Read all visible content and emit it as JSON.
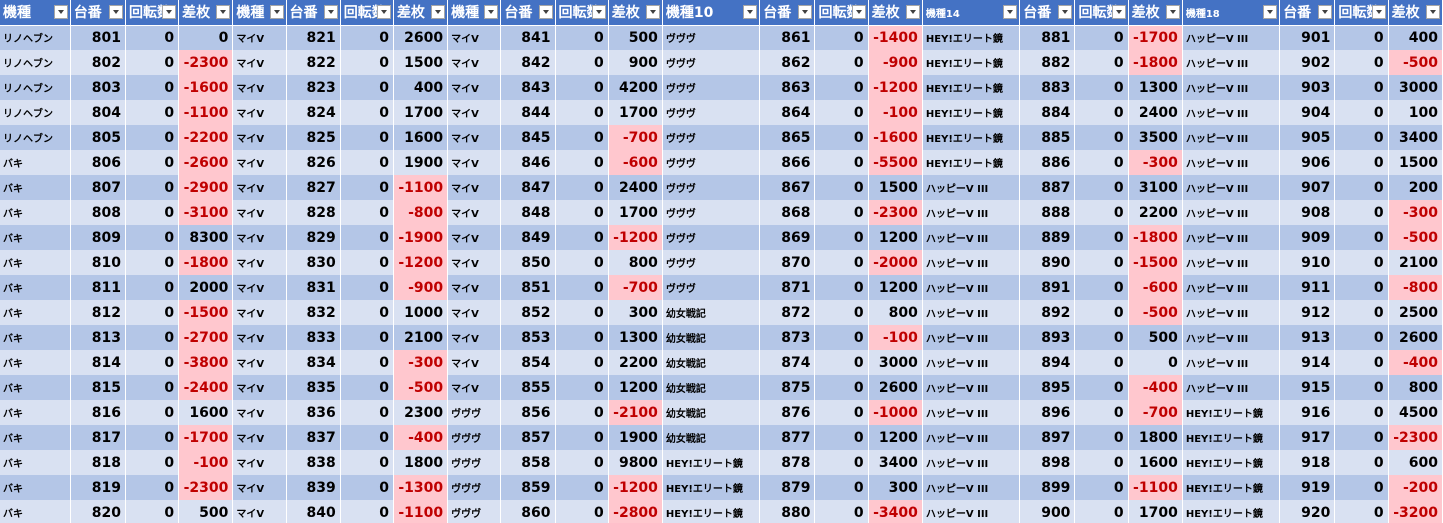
{
  "sheet": {
    "headers": [
      "機種",
      "台番",
      "回転数",
      "差枚",
      "機種",
      "台番",
      "回転数",
      "差枚",
      "機種",
      "台番",
      "回転数",
      "差枚",
      "機種10",
      "台番",
      "回転数",
      "差枚",
      "機種14",
      "台番",
      "回転数",
      "差枚",
      "機種18",
      "台番",
      "回転数",
      "差枚"
    ],
    "filter_button_icon": "filter-dropdown-icon",
    "colors": {
      "header_fill": "#4472c4",
      "row_band_dark": "#b4c6e7",
      "row_band_light": "#d9e1f2",
      "negative_fill": "#ffc7ce",
      "negative_text": "#c00000"
    },
    "rows": [
      [
        "リノヘブン",
        "801",
        "0",
        "0",
        "マイV",
        "821",
        "0",
        "2600",
        "マイV",
        "841",
        "0",
        "500",
        "ヴヴヴ",
        "861",
        "0",
        "-1400",
        "HEY!エリート鏡",
        "881",
        "0",
        "-1700",
        "ハッピーV III",
        "901",
        "0",
        "400"
      ],
      [
        "リノヘブン",
        "802",
        "0",
        "-2300",
        "マイV",
        "822",
        "0",
        "1500",
        "マイV",
        "842",
        "0",
        "900",
        "ヴヴヴ",
        "862",
        "0",
        "-900",
        "HEY!エリート鏡",
        "882",
        "0",
        "-1800",
        "ハッピーV III",
        "902",
        "0",
        "-500"
      ],
      [
        "リノヘブン",
        "803",
        "0",
        "-1600",
        "マイV",
        "823",
        "0",
        "400",
        "マイV",
        "843",
        "0",
        "4200",
        "ヴヴヴ",
        "863",
        "0",
        "-1200",
        "HEY!エリート鏡",
        "883",
        "0",
        "1300",
        "ハッピーV III",
        "903",
        "0",
        "3000"
      ],
      [
        "リノヘブン",
        "804",
        "0",
        "-1100",
        "マイV",
        "824",
        "0",
        "1700",
        "マイV",
        "844",
        "0",
        "1700",
        "ヴヴヴ",
        "864",
        "0",
        "-100",
        "HEY!エリート鏡",
        "884",
        "0",
        "2400",
        "ハッピーV III",
        "904",
        "0",
        "100"
      ],
      [
        "リノヘブン",
        "805",
        "0",
        "-2200",
        "マイV",
        "825",
        "0",
        "1600",
        "マイV",
        "845",
        "0",
        "-700",
        "ヴヴヴ",
        "865",
        "0",
        "-1600",
        "HEY!エリート鏡",
        "885",
        "0",
        "3500",
        "ハッピーV III",
        "905",
        "0",
        "3400"
      ],
      [
        "バキ",
        "806",
        "0",
        "-2600",
        "マイV",
        "826",
        "0",
        "1900",
        "マイV",
        "846",
        "0",
        "-600",
        "ヴヴヴ",
        "866",
        "0",
        "-5500",
        "HEY!エリート鏡",
        "886",
        "0",
        "-300",
        "ハッピーV III",
        "906",
        "0",
        "1500"
      ],
      [
        "バキ",
        "807",
        "0",
        "-2900",
        "マイV",
        "827",
        "0",
        "-1100",
        "マイV",
        "847",
        "0",
        "2400",
        "ヴヴヴ",
        "867",
        "0",
        "1500",
        "ハッピーV III",
        "887",
        "0",
        "3100",
        "ハッピーV III",
        "907",
        "0",
        "200"
      ],
      [
        "バキ",
        "808",
        "0",
        "-3100",
        "マイV",
        "828",
        "0",
        "-800",
        "マイV",
        "848",
        "0",
        "1700",
        "ヴヴヴ",
        "868",
        "0",
        "-2300",
        "ハッピーV III",
        "888",
        "0",
        "2200",
        "ハッピーV III",
        "908",
        "0",
        "-300"
      ],
      [
        "バキ",
        "809",
        "0",
        "8300",
        "マイV",
        "829",
        "0",
        "-1900",
        "マイV",
        "849",
        "0",
        "-1200",
        "ヴヴヴ",
        "869",
        "0",
        "1200",
        "ハッピーV III",
        "889",
        "0",
        "-1800",
        "ハッピーV III",
        "909",
        "0",
        "-500"
      ],
      [
        "バキ",
        "810",
        "0",
        "-1800",
        "マイV",
        "830",
        "0",
        "-1200",
        "マイV",
        "850",
        "0",
        "800",
        "ヴヴヴ",
        "870",
        "0",
        "-2000",
        "ハッピーV III",
        "890",
        "0",
        "-1500",
        "ハッピーV III",
        "910",
        "0",
        "2100"
      ],
      [
        "バキ",
        "811",
        "0",
        "2000",
        "マイV",
        "831",
        "0",
        "-900",
        "マイV",
        "851",
        "0",
        "-700",
        "ヴヴヴ",
        "871",
        "0",
        "1200",
        "ハッピーV III",
        "891",
        "0",
        "-600",
        "ハッピーV III",
        "911",
        "0",
        "-800"
      ],
      [
        "バキ",
        "812",
        "0",
        "-1500",
        "マイV",
        "832",
        "0",
        "1000",
        "マイV",
        "852",
        "0",
        "300",
        "幼女戦記",
        "872",
        "0",
        "800",
        "ハッピーV III",
        "892",
        "0",
        "-500",
        "ハッピーV III",
        "912",
        "0",
        "2500"
      ],
      [
        "バキ",
        "813",
        "0",
        "-2700",
        "マイV",
        "833",
        "0",
        "2100",
        "マイV",
        "853",
        "0",
        "1300",
        "幼女戦記",
        "873",
        "0",
        "-100",
        "ハッピーV III",
        "893",
        "0",
        "500",
        "ハッピーV III",
        "913",
        "0",
        "2600"
      ],
      [
        "バキ",
        "814",
        "0",
        "-3800",
        "マイV",
        "834",
        "0",
        "-300",
        "マイV",
        "854",
        "0",
        "2200",
        "幼女戦記",
        "874",
        "0",
        "3000",
        "ハッピーV III",
        "894",
        "0",
        "0",
        "ハッピーV III",
        "914",
        "0",
        "-400"
      ],
      [
        "バキ",
        "815",
        "0",
        "-2400",
        "マイV",
        "835",
        "0",
        "-500",
        "マイV",
        "855",
        "0",
        "1200",
        "幼女戦記",
        "875",
        "0",
        "2600",
        "ハッピーV III",
        "895",
        "0",
        "-400",
        "ハッピーV III",
        "915",
        "0",
        "800"
      ],
      [
        "バキ",
        "816",
        "0",
        "1600",
        "マイV",
        "836",
        "0",
        "2300",
        "ヴヴヴ",
        "856",
        "0",
        "-2100",
        "幼女戦記",
        "876",
        "0",
        "-1000",
        "ハッピーV III",
        "896",
        "0",
        "-700",
        "HEY!エリート鏡",
        "916",
        "0",
        "4500"
      ],
      [
        "バキ",
        "817",
        "0",
        "-1700",
        "マイV",
        "837",
        "0",
        "-400",
        "ヴヴヴ",
        "857",
        "0",
        "1900",
        "幼女戦記",
        "877",
        "0",
        "1200",
        "ハッピーV III",
        "897",
        "0",
        "1800",
        "HEY!エリート鏡",
        "917",
        "0",
        "-2300"
      ],
      [
        "バキ",
        "818",
        "0",
        "-100",
        "マイV",
        "838",
        "0",
        "1800",
        "ヴヴヴ",
        "858",
        "0",
        "9800",
        "HEY!エリート鏡",
        "878",
        "0",
        "3400",
        "ハッピーV III",
        "898",
        "0",
        "1600",
        "HEY!エリート鏡",
        "918",
        "0",
        "600"
      ],
      [
        "バキ",
        "819",
        "0",
        "-2300",
        "マイV",
        "839",
        "0",
        "-1300",
        "ヴヴヴ",
        "859",
        "0",
        "-1200",
        "HEY!エリート鏡",
        "879",
        "0",
        "300",
        "ハッピーV III",
        "899",
        "0",
        "-1100",
        "HEY!エリート鏡",
        "919",
        "0",
        "-200"
      ],
      [
        "バキ",
        "820",
        "0",
        "500",
        "マイV",
        "840",
        "0",
        "-1100",
        "ヴヴヴ",
        "860",
        "0",
        "-2800",
        "HEY!エリート鏡",
        "880",
        "0",
        "-3400",
        "ハッピーV III",
        "900",
        "0",
        "1700",
        "HEY!エリート鏡",
        "920",
        "0",
        "-3200"
      ]
    ]
  }
}
